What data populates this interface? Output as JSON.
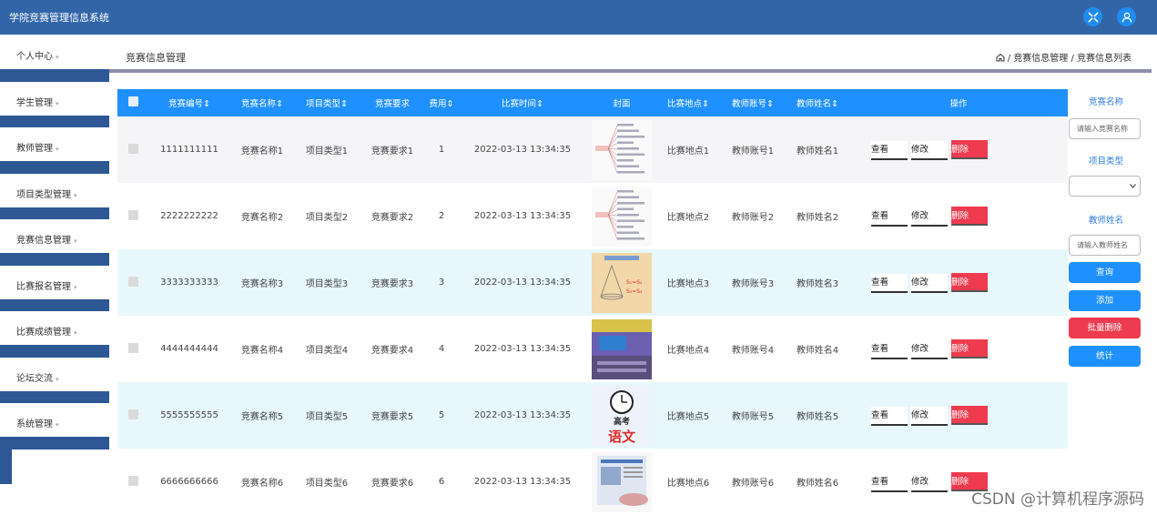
{
  "app": {
    "title": "学院竞赛管理信息系统"
  },
  "sidebar": {
    "items": [
      {
        "label": "个人中心"
      },
      {
        "label": "学生管理"
      },
      {
        "label": "教师管理"
      },
      {
        "label": "项目类型管理"
      },
      {
        "label": "竞赛信息管理"
      },
      {
        "label": "比赛报名管理"
      },
      {
        "label": "比赛成绩管理"
      },
      {
        "label": "论坛交流"
      },
      {
        "label": "系统管理"
      }
    ]
  },
  "page": {
    "title": "竞赛信息管理",
    "breadcrumb": "/ 竞赛信息管理 / 竞赛信息列表"
  },
  "table": {
    "headers": [
      "竞赛编号",
      "竞赛名称",
      "项目类型",
      "竞赛要求",
      "费用",
      "比赛时间",
      "封面",
      "比赛地点",
      "教师账号",
      "教师姓名",
      "操作"
    ],
    "actions": {
      "view": "查看",
      "edit": "修改",
      "delete": "删除"
    },
    "rows": [
      {
        "id": "1111111111",
        "name": "竞赛名称1",
        "type": "项目类型1",
        "req": "竞赛要求1",
        "fee": "1",
        "time": "2022-03-13 13:34:35",
        "place": "比赛地点1",
        "tacc": "教师账号1",
        "tname": "教师姓名1",
        "cover": "mindmap"
      },
      {
        "id": "2222222222",
        "name": "竞赛名称2",
        "type": "项目类型2",
        "req": "竞赛要求2",
        "fee": "2",
        "time": "2022-03-13 13:34:35",
        "place": "比赛地点2",
        "tacc": "教师账号2",
        "tname": "教师姓名2",
        "cover": "mindmap"
      },
      {
        "id": "3333333333",
        "name": "竞赛名称3",
        "type": "项目类型3",
        "req": "竞赛要求3",
        "fee": "3",
        "time": "2022-03-13 13:34:35",
        "place": "比赛地点3",
        "tacc": "教师账号3",
        "tname": "教师姓名3",
        "cover": "geometry"
      },
      {
        "id": "4444444444",
        "name": "竞赛名称4",
        "type": "项目类型4",
        "req": "竞赛要求4",
        "fee": "4",
        "time": "2022-03-13 13:34:35",
        "place": "比赛地点4",
        "tacc": "教师账号4",
        "tname": "教师姓名4",
        "cover": "classroom"
      },
      {
        "id": "5555555555",
        "name": "竞赛名称5",
        "type": "项目类型5",
        "req": "竞赛要求5",
        "fee": "5",
        "time": "2022-03-13 13:34:35",
        "place": "比赛地点5",
        "tacc": "教师账号5",
        "tname": "教师姓名5",
        "cover": "chinese",
        "cover_text": [
          "高考",
          "语文"
        ]
      },
      {
        "id": "6666666666",
        "name": "竞赛名称6",
        "type": "项目类型6",
        "req": "竞赛要求6",
        "fee": "6",
        "time": "2022-03-13 13:34:35",
        "place": "比赛地点6",
        "tacc": "教师账号6",
        "tname": "教师姓名6",
        "cover": "paper"
      }
    ]
  },
  "search": {
    "name_label": "竞赛名称",
    "name_placeholder": "请输入竞赛名称",
    "type_label": "项目类型",
    "teacher_label": "教师姓名",
    "teacher_placeholder": "请输入教师姓名",
    "query": "查询",
    "add": "添加",
    "batch_delete": "批量删除",
    "stats": "统计"
  },
  "watermark": "CSDN @计算机程序源码"
}
